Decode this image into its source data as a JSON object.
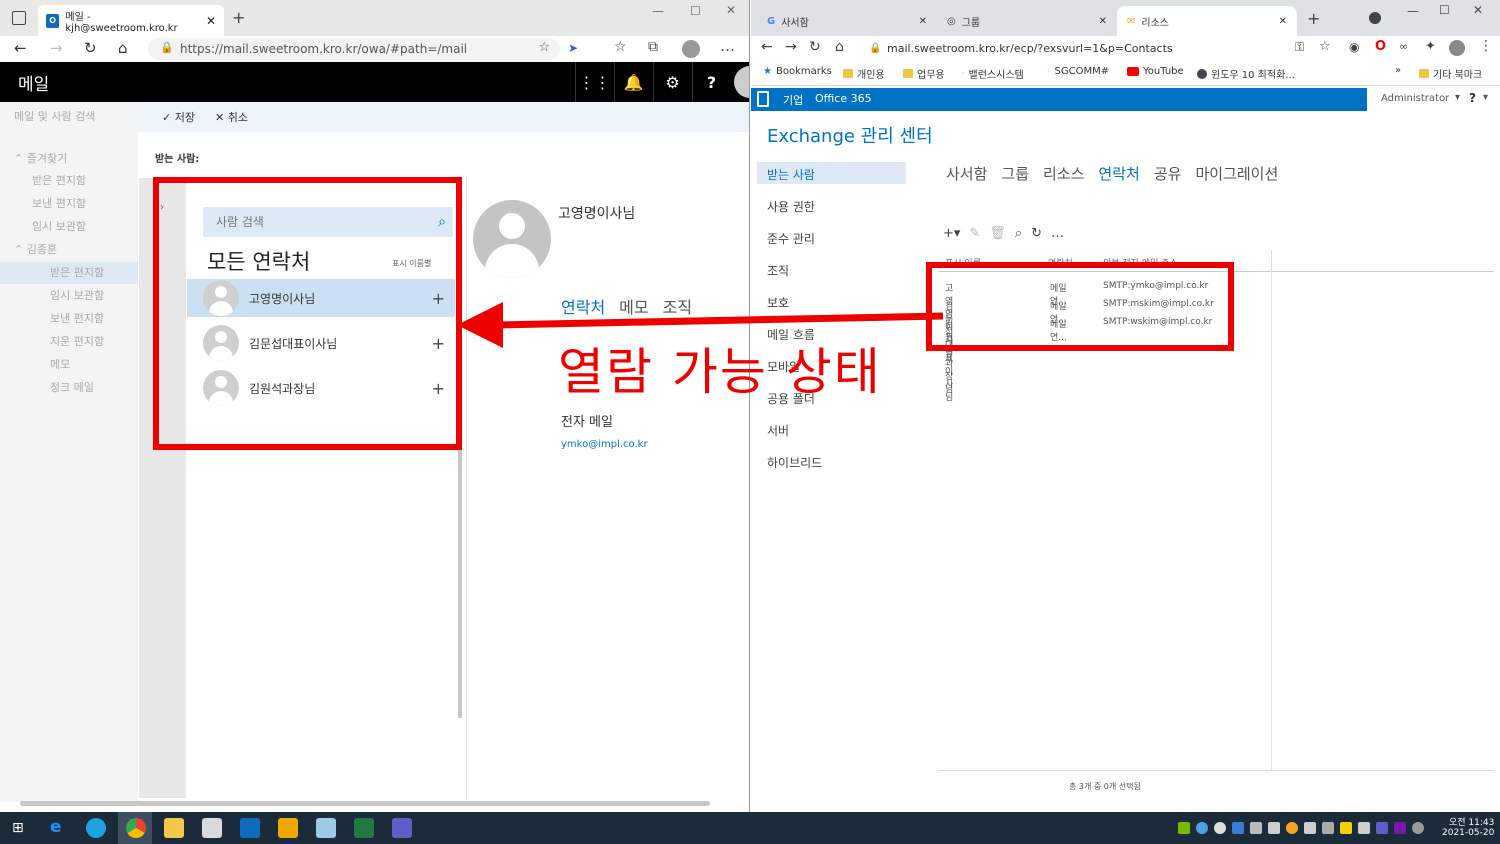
{
  "left_browser": {
    "tab_title": "메일 - kjh@sweetroom.kro.kr",
    "url": "https://mail.sweetroom.kro.kr/owa/#path=/mail",
    "app_title": "메일",
    "nav": {
      "search_placeholder": "메일 및 사람 검색",
      "favorites": "즐겨찾기",
      "items": [
        "받은 편지함",
        "보낸 편지함",
        "임시 보관함"
      ],
      "account": "김종훈",
      "account_items": [
        "받은 편지함",
        "임시 보관함",
        "보낸 편지함",
        "지운 편지함",
        "메모",
        "정크 메일"
      ]
    },
    "toolbar": {
      "save": "저장",
      "cancel": "취소"
    },
    "to_label": "받는 사람:",
    "people": {
      "search_placeholder": "사람 검색",
      "heading": "모든 연락처",
      "sort_label": "표시 이름별",
      "contacts": [
        "고영명이사님",
        "김문섭대표이사님",
        "김원석과장님"
      ]
    },
    "detail": {
      "name": "고영명이사님",
      "tabs": [
        "연락처",
        "메모",
        "조직"
      ],
      "email_label": "전자 메일",
      "email": "ymko@impl.co.kr"
    }
  },
  "annotation": {
    "text": "열람 가능 상태",
    "color": "#ee0000"
  },
  "right_browser": {
    "tabs": [
      "사서함",
      "그룹",
      "리소스",
      "연락처",
      "공유",
      "마이그레이션"
    ],
    "url": "mail.sweetroom.kro.kr/ecp/?exsvurl=1&p=Contacts",
    "bookmarks": [
      "Bookmarks",
      "개인용",
      "업무용",
      "밸런스시스템",
      "SGCOMM#",
      "YouTube",
      "윈도우 10 최적화...",
      "기타 북마크"
    ],
    "o365": {
      "enterprise": "기업",
      "office": "Office 365",
      "user": "Administrator",
      "help": "?"
    },
    "ecp_title": "Exchange 관리 센터",
    "nav": [
      "받는 사람",
      "사용 권한",
      "준수 관리",
      "조직",
      "보호",
      "메일 흐름",
      "모바일",
      "공용 폴더",
      "서버",
      "하이브리드"
    ],
    "columns": [
      "표시 이름",
      "연락처",
      "외부 전자 메일 주소"
    ],
    "rows": [
      {
        "name": "고영명이사님",
        "type": "메일 연...",
        "email": "SMTP:ymko@impl.co.kr"
      },
      {
        "name": "김문섭대표이사님",
        "type": "메일 연...",
        "email": "SMTP:mskim@impl.co.kr"
      },
      {
        "name": "김원석과장님",
        "type": "메일 연...",
        "email": "SMTP:wskim@impl.co.kr"
      }
    ],
    "status": "총 3개 중 0개 선택됨"
  },
  "taskbar": {
    "time": "오전 11:43",
    "date": "2021-05-20"
  },
  "colors": {
    "accent": "#0072c6",
    "annotation": "#ee0000"
  }
}
